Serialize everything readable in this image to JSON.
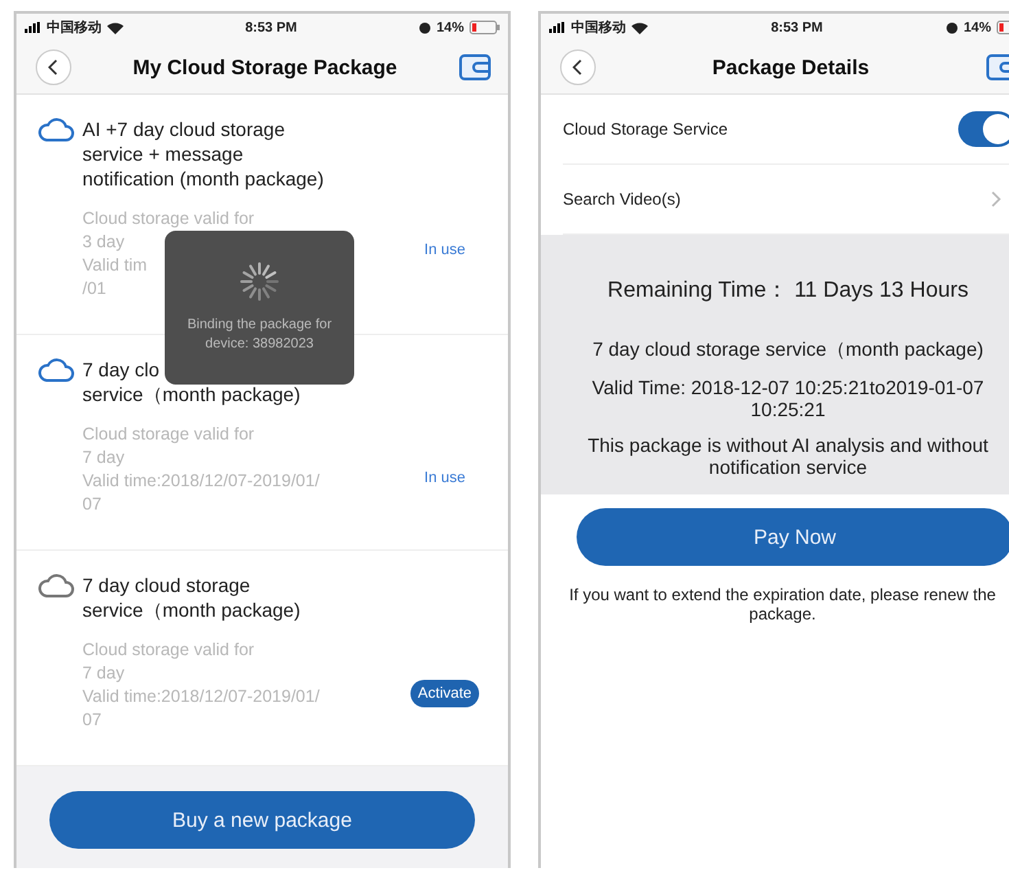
{
  "screens": [
    {
      "status_bar": {
        "carrier": "中国移动",
        "time": "8:53 PM",
        "battery": "14%"
      },
      "title": "My Cloud Storage Package",
      "packages": [
        {
          "title_lines": [
            "AI +7 day cloud storage",
            "service + message",
            "notification (month package)"
          ],
          "active": true,
          "details": [
            "Cloud storage valid for",
            "3 day",
            "Valid tim",
            "/01"
          ],
          "status": {
            "kind": "label",
            "text": "In use"
          }
        },
        {
          "title_lines": [
            "7 day clo",
            "service（month package)"
          ],
          "active": true,
          "details": [
            "Cloud storage valid for",
            "7 day",
            "Valid time:2018/12/07-2019/01/",
            "07"
          ],
          "status": {
            "kind": "label",
            "text": "In use"
          }
        },
        {
          "title_lines": [
            "7 day cloud storage",
            "service（month package)"
          ],
          "active": false,
          "details": [
            "Cloud storage valid for",
            "7 day",
            "Valid time:2018/12/07-2019/01/",
            "07"
          ],
          "status": {
            "kind": "button",
            "text": "Activate"
          }
        }
      ],
      "toast": "Binding the package for device: 38982023",
      "action": "Buy a new package"
    },
    {
      "status_bar": {
        "carrier": "中国移动",
        "time": "8:53 PM",
        "battery": "14%"
      },
      "title": "Package Details",
      "settings": [
        {
          "kind": "toggle",
          "label": "Cloud Storage Service",
          "on": true
        },
        {
          "kind": "link",
          "label": "Search Video(s)"
        }
      ],
      "info": [
        "Remaining Time： 11 Days 13 Hours",
        "7 day cloud storage service（month package)",
        "Valid Time: 2018-12-07 10:25:21to2019-01-07 10:25:21",
        "This package is without AI analysis and without notification service"
      ],
      "action": "Pay Now",
      "note": "If you want to extend the expiration date, please renew the package."
    }
  ]
}
